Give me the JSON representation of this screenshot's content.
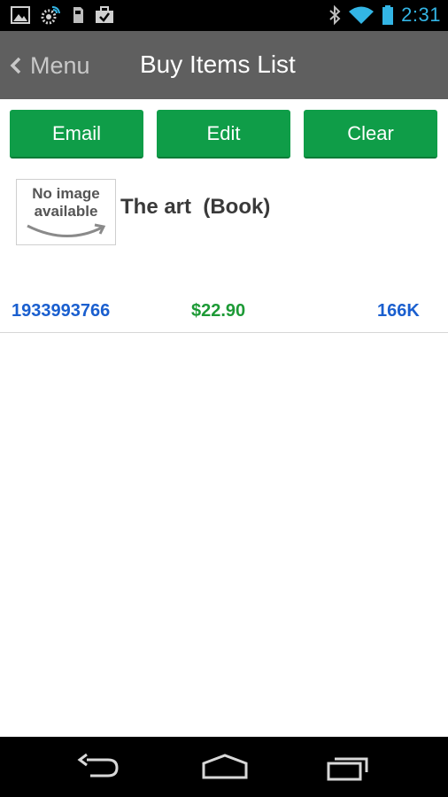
{
  "status_bar": {
    "time": "2:31",
    "icons_left": [
      "picture-icon",
      "sync-gear-icon",
      "sd-card-icon",
      "briefcase-check-icon"
    ],
    "icons_right": [
      "bluetooth-icon",
      "wifi-icon",
      "battery-icon"
    ],
    "accent_color": "#33b5e5"
  },
  "action_bar": {
    "back_label": "Menu",
    "title": "Buy Items List",
    "background": "#5f5f5f"
  },
  "buttons": {
    "email": "Email",
    "edit": "Edit",
    "clear": "Clear",
    "color": "#0f9d48"
  },
  "item": {
    "thumbnail_text": "No image\navailable",
    "title": "The art  (Book)",
    "isbn": "1933993766",
    "price": "$22.90",
    "size": "166K"
  },
  "nav_bar": {
    "icons": [
      "back-icon",
      "home-icon",
      "recent-apps-icon"
    ]
  }
}
